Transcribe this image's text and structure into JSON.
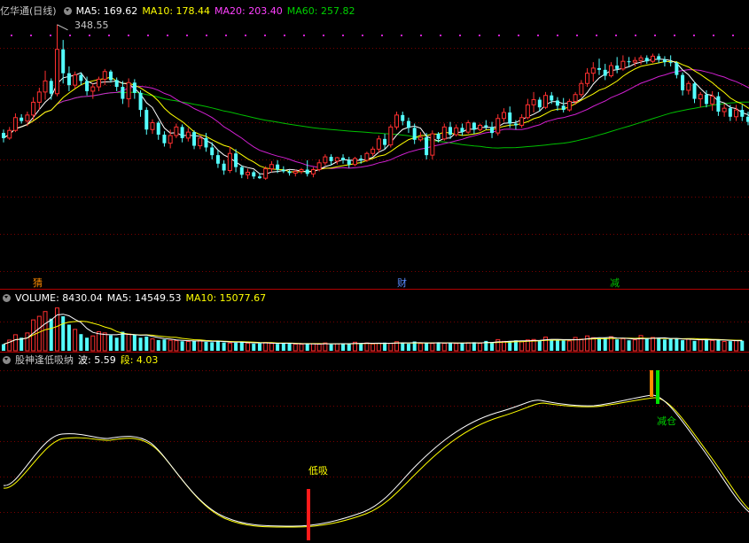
{
  "header_price": {
    "title": "亿华通(日线)",
    "ma5": "MA5: 169.62",
    "ma10": "MA10: 178.44",
    "ma20": "MA20: 203.40",
    "ma60": "MA60: 257.82",
    "colors": {
      "title": "#c8c8c8",
      "ma5": "#ffffff",
      "ma10": "#ffff00",
      "ma20": "#ff40ff",
      "ma60": "#00d000"
    }
  },
  "high_marker": "348.55",
  "events": [
    {
      "label": "猜",
      "color": "#ff8c00"
    },
    {
      "label": "财",
      "color": "#5a8cff"
    },
    {
      "label": "减",
      "color": "#00c000"
    }
  ],
  "header_volume": {
    "volume": "VOLUME: 8430.04",
    "ma5": "MA5: 14549.53",
    "ma10": "MA10: 15077.67"
  },
  "header_indicator": {
    "name": "股神逢低吸纳",
    "bo": "波: 5.59",
    "duan": "段: 4.03"
  },
  "signals": {
    "buy_label": "低吸",
    "sell_label": "减仓"
  },
  "chart_data": [
    {
      "type": "candlestick",
      "title": "亿华通(日线)",
      "high_annotation": 348.55,
      "ohlc": [
        [
          222,
          226,
          211,
          216
        ],
        [
          216,
          229,
          214,
          225
        ],
        [
          225,
          245,
          223,
          240
        ],
        [
          240,
          244,
          233,
          236
        ],
        [
          236,
          247,
          230,
          243
        ],
        [
          243,
          264,
          237,
          258
        ],
        [
          258,
          275,
          249,
          270
        ],
        [
          270,
          295,
          261,
          283
        ],
        [
          283,
          286,
          261,
          268
        ],
        [
          268,
          349,
          265,
          320
        ],
        [
          320,
          331,
          280,
          292
        ],
        [
          292,
          300,
          271,
          278
        ],
        [
          278,
          294,
          274,
          290
        ],
        [
          290,
          293,
          278,
          283
        ],
        [
          283,
          288,
          266,
          271
        ],
        [
          271,
          280,
          262,
          276
        ],
        [
          276,
          288,
          271,
          285
        ],
        [
          285,
          297,
          278,
          294
        ],
        [
          294,
          296,
          281,
          284
        ],
        [
          284,
          287,
          271,
          276
        ],
        [
          276,
          283,
          256,
          262
        ],
        [
          262,
          286,
          252,
          281
        ],
        [
          281,
          285,
          262,
          269
        ],
        [
          269,
          272,
          241,
          249
        ],
        [
          249,
          252,
          220,
          226
        ],
        [
          226,
          238,
          221,
          234
        ],
        [
          234,
          236,
          214,
          220
        ],
        [
          220,
          224,
          206,
          210
        ],
        [
          210,
          226,
          204,
          219
        ],
        [
          219,
          233,
          216,
          229
        ],
        [
          229,
          232,
          211,
          216
        ],
        [
          216,
          228,
          212,
          223
        ],
        [
          223,
          225,
          203,
          207
        ],
        [
          207,
          219,
          203,
          216
        ],
        [
          216,
          222,
          200,
          205
        ],
        [
          205,
          211,
          191,
          196
        ],
        [
          196,
          202,
          181,
          186
        ],
        [
          186,
          190,
          173,
          178
        ],
        [
          178,
          206,
          175,
          198
        ],
        [
          198,
          203,
          176,
          182
        ],
        [
          182,
          184,
          169,
          173
        ],
        [
          173,
          180,
          168,
          176
        ],
        [
          176,
          178,
          168,
          171
        ],
        [
          171,
          175,
          168,
          169
        ],
        [
          169,
          183,
          167,
          180
        ],
        [
          180,
          189,
          176,
          185
        ],
        [
          185,
          190,
          175,
          179
        ],
        [
          179,
          183,
          175,
          177
        ],
        [
          177,
          179,
          172,
          175
        ],
        [
          175,
          179,
          171,
          177
        ],
        [
          177,
          181,
          174,
          179
        ],
        [
          179,
          190,
          171,
          174
        ],
        [
          174,
          182,
          170,
          179
        ],
        [
          179,
          191,
          177,
          187
        ],
        [
          187,
          197,
          184,
          194
        ],
        [
          194,
          197,
          184,
          189
        ],
        [
          189,
          194,
          185,
          193
        ],
        [
          193,
          197,
          186,
          190
        ],
        [
          190,
          194,
          181,
          185
        ],
        [
          185,
          194,
          183,
          192
        ],
        [
          192,
          196,
          186,
          190
        ],
        [
          190,
          200,
          188,
          198
        ],
        [
          198,
          206,
          195,
          203
        ],
        [
          203,
          219,
          199,
          215
        ],
        [
          215,
          221,
          203,
          208
        ],
        [
          208,
          232,
          205,
          229
        ],
        [
          229,
          247,
          226,
          243
        ],
        [
          243,
          247,
          231,
          236
        ],
        [
          236,
          240,
          222,
          228
        ],
        [
          228,
          233,
          209,
          214
        ],
        [
          214,
          223,
          212,
          217
        ],
        [
          217,
          222,
          191,
          196
        ],
        [
          196,
          225,
          191,
          221
        ],
        [
          221,
          223,
          211,
          215
        ],
        [
          215,
          233,
          213,
          229
        ],
        [
          229,
          235,
          215,
          220
        ],
        [
          220,
          232,
          218,
          228
        ],
        [
          228,
          233,
          219,
          223
        ],
        [
          223,
          237,
          221,
          234
        ],
        [
          234,
          235,
          221,
          226
        ],
        [
          226,
          233,
          224,
          231
        ],
        [
          231,
          237,
          226,
          229
        ],
        [
          229,
          235,
          216,
          222
        ],
        [
          222,
          244,
          219,
          239
        ],
        [
          239,
          251,
          235,
          246
        ],
        [
          246,
          253,
          228,
          233
        ],
        [
          233,
          237,
          226,
          231
        ],
        [
          231,
          244,
          228,
          240
        ],
        [
          240,
          262,
          238,
          255
        ],
        [
          255,
          270,
          246,
          261
        ],
        [
          261,
          264,
          247,
          252
        ],
        [
          252,
          270,
          250,
          266
        ],
        [
          266,
          270,
          256,
          260
        ],
        [
          260,
          264,
          248,
          254
        ],
        [
          254,
          263,
          246,
          249
        ],
        [
          249,
          262,
          247,
          259
        ],
        [
          259,
          270,
          255,
          267
        ],
        [
          267,
          284,
          264,
          280
        ],
        [
          280,
          298,
          276,
          292
        ],
        [
          292,
          305,
          282,
          298
        ],
        [
          298,
          309,
          290,
          296
        ],
        [
          296,
          303,
          284,
          289
        ],
        [
          289,
          305,
          287,
          301
        ],
        [
          301,
          311,
          292,
          297
        ],
        [
          297,
          313,
          295,
          306
        ],
        [
          306,
          311,
          299,
          305
        ],
        [
          305,
          311,
          300,
          307
        ],
        [
          307,
          313,
          302,
          310
        ],
        [
          310,
          313,
          303,
          306
        ],
        [
          306,
          315,
          304,
          312
        ],
        [
          312,
          315,
          304,
          308
        ],
        [
          308,
          312,
          300,
          305
        ],
        [
          305,
          313,
          300,
          304
        ],
        [
          304,
          306,
          286,
          290
        ],
        [
          290,
          293,
          266,
          272
        ],
        [
          272,
          283,
          267,
          280
        ],
        [
          280,
          282,
          257,
          262
        ],
        [
          262,
          270,
          252,
          267
        ],
        [
          267,
          272,
          252,
          256
        ],
        [
          256,
          271,
          248,
          265
        ],
        [
          265,
          270,
          242,
          247
        ],
        [
          247,
          256,
          241,
          251
        ],
        [
          251,
          255,
          236,
          241
        ],
        [
          241,
          255,
          236,
          249
        ],
        [
          249,
          255,
          236,
          241
        ],
        [
          241,
          247,
          231,
          235
        ],
        [
          235,
          238,
          212,
          219
        ]
      ],
      "series": [
        {
          "name": "MA5",
          "last_value": 169.62
        },
        {
          "name": "MA10",
          "last_value": 178.44
        },
        {
          "name": "MA20",
          "last_value": 203.4
        },
        {
          "name": "MA60",
          "last_value": 257.82
        }
      ],
      "y_range": [
        165,
        355
      ]
    },
    {
      "type": "bar",
      "title": "VOLUME",
      "values": [
        5500,
        9000,
        13500,
        11000,
        15000,
        26000,
        29000,
        33000,
        27000,
        36000,
        29000,
        22000,
        18000,
        14000,
        11000,
        12500,
        16000,
        15000,
        13000,
        11000,
        16000,
        14000,
        13500,
        11000,
        12000,
        10000,
        9000,
        9500,
        8800,
        8500,
        8000,
        7800,
        8200,
        9000,
        7500,
        7200,
        8500,
        7000,
        6500,
        6800,
        7600,
        6500,
        6000,
        6200,
        7000,
        6200,
        5800,
        6500,
        6000,
        5600,
        5500,
        5800,
        6000,
        5600,
        6600,
        5400,
        5900,
        6200,
        5800,
        7200,
        6100,
        6600,
        5800,
        6300,
        6900,
        6200,
        7600,
        6400,
        5900,
        7800,
        6100,
        6800,
        6200,
        7100,
        6300,
        6900,
        6100,
        6500,
        6800,
        7200,
        6300,
        8300,
        6600,
        9400,
        7900,
        8200,
        8800,
        7600,
        9100,
        9500,
        8500,
        11500,
        9500,
        8900,
        8600,
        8300,
        11200,
        9800,
        12500,
        11000,
        10500,
        10800,
        11800,
        9600,
        10200,
        8800,
        9200,
        12800,
        10000,
        11200,
        10800,
        9500,
        10300,
        10200,
        8900,
        9800,
        8300,
        9200,
        10100,
        8700,
        9400,
        7800,
        8100,
        8600,
        8430
      ],
      "volume_last": 8430.04,
      "ma5_last": 14549.53,
      "ma10_last": 15077.67,
      "y_range": [
        0,
        38000
      ]
    },
    {
      "type": "line",
      "title": "股神逢低吸纳",
      "series": [
        {
          "name": "波",
          "last_value": 5.59
        },
        {
          "name": "段",
          "last_value": 4.03
        }
      ],
      "signals": [
        {
          "label": "低吸",
          "type": "buy"
        },
        {
          "label": "减仓",
          "type": "sell"
        }
      ]
    }
  ]
}
